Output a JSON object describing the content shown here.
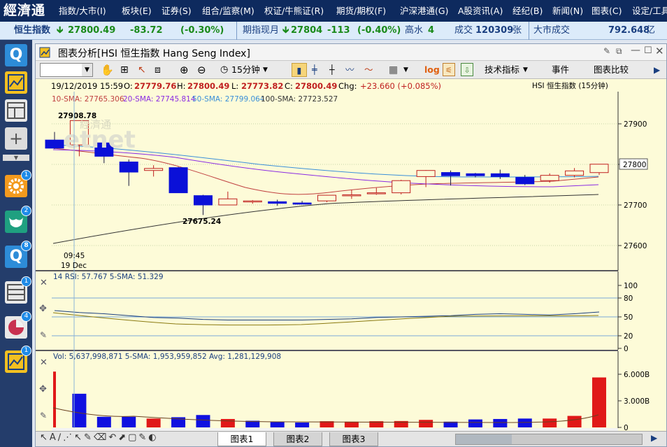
{
  "app": {
    "logo": "經濟通"
  },
  "menu": [
    {
      "label": "指数/大市(I)"
    },
    {
      "label": "板块(E)"
    },
    {
      "label": "证券(S)"
    },
    {
      "label": "组合/监察(M)"
    },
    {
      "label": "权证/牛熊证(R)"
    },
    {
      "label": "期货/期权(F)"
    },
    {
      "label": "沪深港通(G)"
    },
    {
      "label": "A股资讯(A)"
    },
    {
      "label": "经纪(B)"
    },
    {
      "label": "新闻(N)"
    },
    {
      "label": "图表(C)"
    },
    {
      "label": "设定/工具"
    }
  ],
  "ticker": {
    "name": "恒生指数",
    "value": "27800.49",
    "change": "-83.72",
    "pct": "(-0.30%)",
    "fut_label": "期指现月",
    "fut_value": "27804",
    "fut_change": "-113",
    "fut_pct": "(-0.40%)",
    "premium_label": "高水",
    "premium": "4",
    "vol_label": "成交",
    "vol": "120309",
    "vol_unit": "张",
    "turnover_label": "大市成交",
    "turnover": "792.648",
    "turnover_unit": "亿"
  },
  "sidebar": {
    "badges": [
      "1",
      "2",
      "8",
      "1",
      "4",
      "1"
    ]
  },
  "window": {
    "title": "图表分析[HSI 恒生指数 Hang Seng Index]"
  },
  "toolbar": {
    "interval": "15分钟",
    "log": "log",
    "indicators": "技术指标",
    "events": "事件",
    "compare": "图表比较"
  },
  "chart": {
    "info": {
      "date": "19/12/2019 15:59",
      "open_label": "O:",
      "open": "27779.76",
      "high_label": "H:",
      "high": "27800.49",
      "low_label": "L:",
      "low": "27773.82",
      "close_label": "C:",
      "close": "27800.49",
      "chg_label": "Chg:",
      "chg": "+23.660 (+0.085%)"
    },
    "symbol": "HSI  恒生指数 (15分钟)",
    "sma": [
      {
        "label": "10-SMA: 27765.306",
        "color": "#c04040"
      },
      {
        "label": "20-SMA: 27745.814",
        "color": "#8a2be2"
      },
      {
        "label": "50-SMA: 27799.064",
        "color": "#3a8fd8"
      },
      {
        "label": "100-SMA: 27723.527",
        "color": "#333333"
      }
    ],
    "high_mark": "27908.78",
    "low_mark": "27675.24",
    "time_label": "09:45",
    "date_label": "19 Dec",
    "watermark": "經濟通"
  },
  "rsi": {
    "label": "14 RSI: 57.767  5-SMA: 51.329"
  },
  "volume": {
    "label": "Vol: 5,637,998,871  5-SMA: 1,953,959,852  Avg: 1,281,129,908"
  },
  "tabs": [
    {
      "label": "图表1"
    },
    {
      "label": "图表2"
    },
    {
      "label": "图表3"
    }
  ],
  "chart_data": [
    {
      "type": "candlestick",
      "yticks": [
        27600,
        27700,
        27800,
        27900
      ],
      "current": 27800,
      "candles": [
        {
          "o": 27860,
          "h": 27880,
          "l": 27838,
          "c": 27840
        },
        {
          "o": 27848,
          "h": 27908.78,
          "l": 27820,
          "c": 27908
        },
        {
          "o": 27853,
          "h": 27858,
          "l": 27803,
          "c": 27820
        },
        {
          "o": 27806,
          "h": 27812,
          "l": 27747,
          "c": 27781
        },
        {
          "o": 27785,
          "h": 27798,
          "l": 27770,
          "c": 27790
        },
        {
          "o": 27792,
          "h": 27794,
          "l": 27730,
          "c": 27730
        },
        {
          "o": 27723,
          "h": 27725,
          "l": 27675.24,
          "c": 27700
        },
        {
          "o": 27700,
          "h": 27733,
          "l": 27700,
          "c": 27715
        },
        {
          "o": 27710,
          "h": 27712,
          "l": 27703,
          "c": 27710
        },
        {
          "o": 27708,
          "h": 27713,
          "l": 27698,
          "c": 27704
        },
        {
          "o": 27705,
          "h": 27710,
          "l": 27702,
          "c": 27702
        },
        {
          "o": 27710,
          "h": 27725,
          "l": 27707,
          "c": 27724
        },
        {
          "o": 27723,
          "h": 27737,
          "l": 27715,
          "c": 27725
        },
        {
          "o": 27728,
          "h": 27742,
          "l": 27725,
          "c": 27730
        },
        {
          "o": 27730,
          "h": 27762,
          "l": 27726,
          "c": 27760
        },
        {
          "o": 27770,
          "h": 27786,
          "l": 27744,
          "c": 27785
        },
        {
          "o": 27780,
          "h": 27785,
          "l": 27748,
          "c": 27772
        },
        {
          "o": 27777,
          "h": 27779,
          "l": 27768,
          "c": 27772
        },
        {
          "o": 27777,
          "h": 27787,
          "l": 27764,
          "c": 27770
        },
        {
          "o": 27768,
          "h": 27774,
          "l": 27749,
          "c": 27752
        },
        {
          "o": 27760,
          "h": 27778,
          "l": 27755,
          "c": 27773
        },
        {
          "o": 27773,
          "h": 27791,
          "l": 27768,
          "c": 27784
        },
        {
          "o": 27779.76,
          "h": 27800.49,
          "l": 27773.82,
          "c": 27800.49
        }
      ]
    },
    {
      "type": "line",
      "name": "14 RSI",
      "yticks": [
        0,
        20,
        50,
        80,
        100
      ],
      "values": [
        60,
        57,
        55,
        52,
        49,
        48,
        46,
        45,
        45,
        45,
        45,
        46,
        47,
        49,
        50,
        51,
        52,
        54,
        55,
        54,
        53,
        55,
        57.767
      ]
    },
    {
      "type": "bar",
      "name": "Vol",
      "ytick_labels": [
        "0",
        "3.000B",
        "6.000B"
      ],
      "ytick_values": [
        0,
        3,
        6
      ],
      "unit": "B",
      "values": [
        6.3,
        3.8,
        1.2,
        1.2,
        1.0,
        1.15,
        1.4,
        0.95,
        0.75,
        0.6,
        0.55,
        0.7,
        0.65,
        0.7,
        0.72,
        0.85,
        0.65,
        0.9,
        0.95,
        1.0,
        1.0,
        1.3,
        5.64
      ],
      "colors": [
        "r",
        "b",
        "b",
        "b",
        "r",
        "b",
        "b",
        "r",
        "b",
        "b",
        "b",
        "r",
        "r",
        "r",
        "r",
        "r",
        "b",
        "b",
        "b",
        "b",
        "r",
        "r",
        "r"
      ]
    }
  ]
}
